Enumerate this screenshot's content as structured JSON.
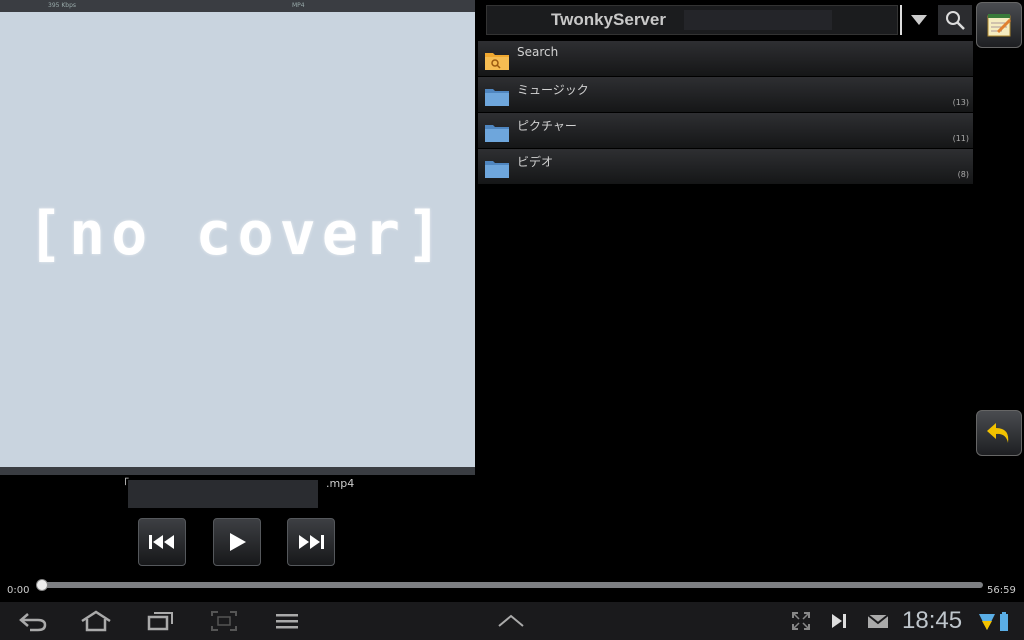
{
  "cover": {
    "bitrate": "395 Kbps",
    "format": "MP4",
    "placeholder": "[no cover]"
  },
  "player": {
    "track_title": "「 ぼけとるから数字の上にフォント」.mp4",
    "track_title_visible": ".mp4",
    "time_current": "0:00",
    "time_total": "56:59",
    "progress": 0.0
  },
  "browser": {
    "server_name": "TwonkyServer",
    "items": [
      {
        "label": "Search",
        "count": "",
        "icon": "search-folder-icon"
      },
      {
        "label": "ミュージック",
        "count": "(13)",
        "icon": "folder-icon"
      },
      {
        "label": "ピクチャー",
        "count": "(11)",
        "icon": "folder-icon"
      },
      {
        "label": "ビデオ",
        "count": "(8)",
        "icon": "folder-icon"
      }
    ]
  },
  "status": {
    "clock": "18:45"
  },
  "colors": {
    "accent_yellow": "#f2c200",
    "folder_blue": "#6ea6dc",
    "search_folder": "#f0a830"
  }
}
